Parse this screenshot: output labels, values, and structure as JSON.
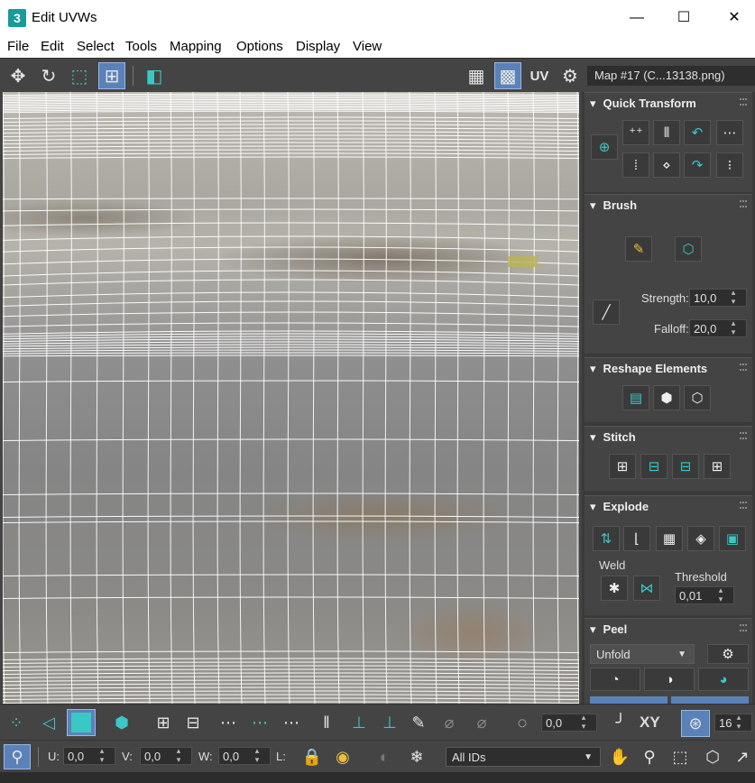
{
  "window": {
    "title": "Edit UVWs",
    "app_icon": "3",
    "minimize": "—",
    "maximize": "☐",
    "close": "✕"
  },
  "menu": [
    "File",
    "Edit",
    "Select",
    "Tools",
    "Mapping",
    "Options",
    "Display",
    "View"
  ],
  "toolbar": {
    "uv_label": "UV",
    "map_selector": "Map #17 (C...13138.png)"
  },
  "panel": {
    "quick_transform": {
      "title": "Quick Transform"
    },
    "brush": {
      "title": "Brush",
      "strength_label": "Strength:",
      "strength_value": "10,0",
      "falloff_label": "Falloff:",
      "falloff_value": "20,0"
    },
    "reshape": {
      "title": "Reshape Elements"
    },
    "stitch": {
      "title": "Stitch"
    },
    "explode": {
      "title": "Explode",
      "weld_label": "Weld",
      "threshold_label": "Threshold",
      "threshold_value": "0,01"
    },
    "peel": {
      "title": "Peel",
      "unfold_value": "Unfold"
    }
  },
  "bottom": {
    "angle_value": "0,0",
    "xy_label": "XY",
    "grid_value": "16",
    "u_label": "U:",
    "u_value": "0,0",
    "v_label": "V:",
    "v_value": "0,0",
    "w_label": "W:",
    "w_value": "0,0",
    "l_label": "L:",
    "ids_value": "All IDs"
  },
  "colors": {
    "accent_teal": "#3cc7c7",
    "active_blue": "#5b82b8",
    "panel_bg": "#444444",
    "mesh_line": "#ffffff",
    "selected_face": "#b8b45a"
  }
}
